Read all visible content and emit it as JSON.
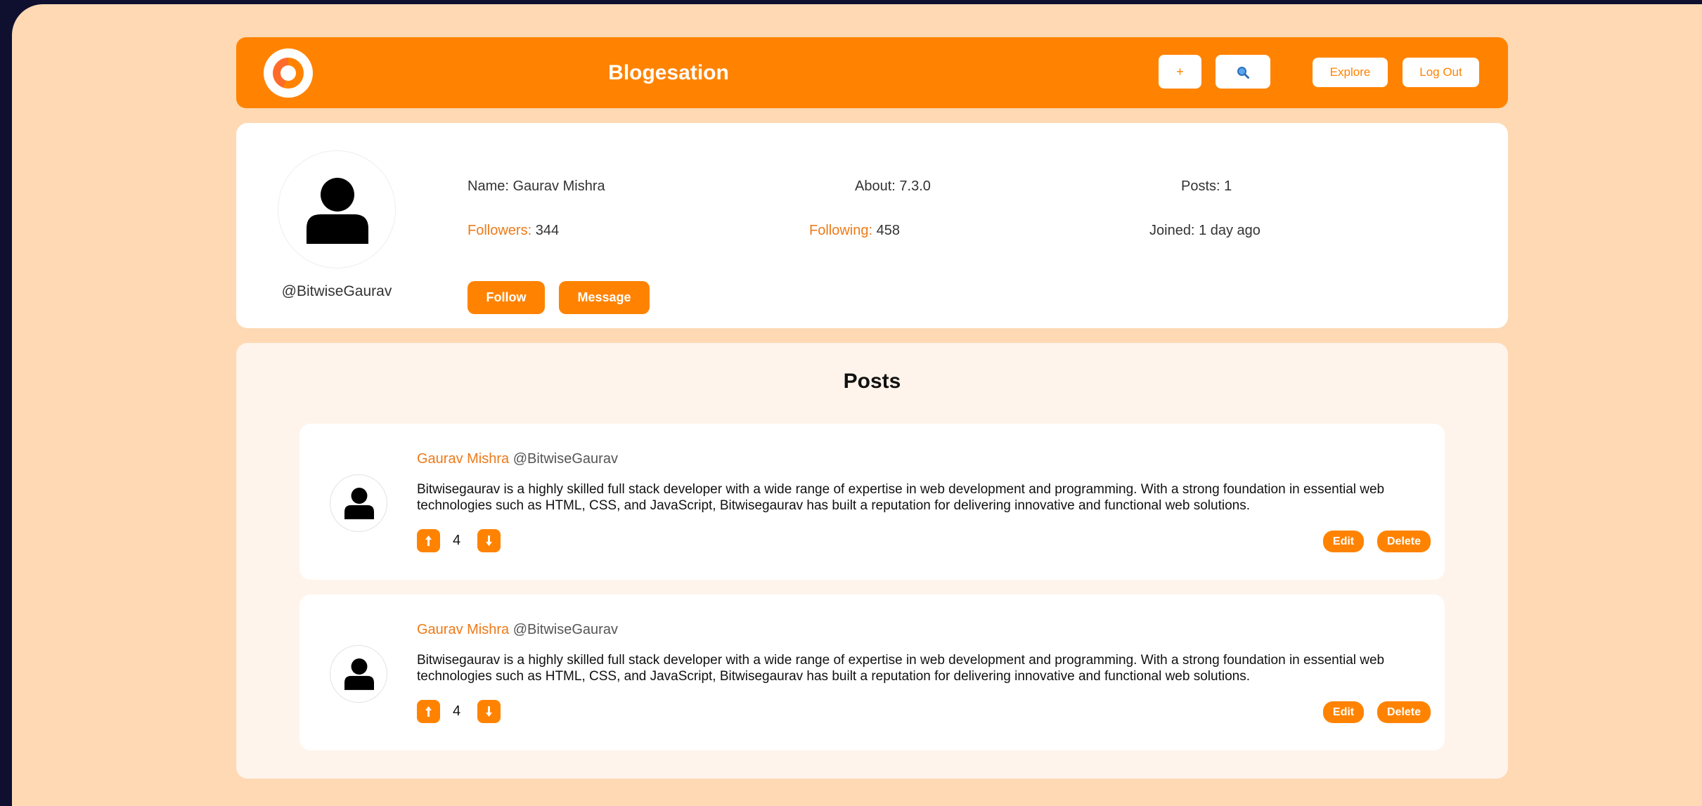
{
  "header": {
    "title": "Blogesation",
    "plus_label": "+",
    "explore_label": "Explore",
    "logout_label": "Log Out",
    "accent_color": "#ff8300"
  },
  "profile": {
    "name_label": "Name: ",
    "name": "Gaurav Mishra",
    "about_label": "About: ",
    "about": "7.3.0",
    "posts_label": "Posts: ",
    "posts": "1",
    "followers_label": "Followers:",
    "followers": "344",
    "following_label": "Following:",
    "following": "458",
    "joined_label": "Joined: ",
    "joined": "1 day ago",
    "handle": "@BitwiseGaurav",
    "follow_label": "Follow",
    "message_label": "Message"
  },
  "posts_section": {
    "title": "Posts",
    "posts": [
      {
        "author": "Gaurav Mishra",
        "handle": "@BitwiseGaurav",
        "body": "Bitwisegaurav is a highly skilled full stack developer with a wide range of expertise in web development and programming. With a strong foundation in essential web technologies such as HTML, CSS, and JavaScript, Bitwisegaurav has built a reputation for delivering innovative and functional web solutions.",
        "votes": "4",
        "edit_label": "Edit",
        "delete_label": "Delete"
      },
      {
        "author": "Gaurav Mishra",
        "handle": "@BitwiseGaurav",
        "body": "Bitwisegaurav is a highly skilled full stack developer with a wide range of expertise in web development and programming. With a strong foundation in essential web technologies such as HTML, CSS, and JavaScript, Bitwisegaurav has built a reputation for delivering innovative and functional web solutions.",
        "votes": "4",
        "edit_label": "Edit",
        "delete_label": "Delete"
      }
    ]
  },
  "icons": {
    "logo": "logo-ring-icon",
    "search": "search-icon",
    "avatar": "user-icon",
    "upvote": "arrow-up-icon",
    "downvote": "arrow-down-icon"
  }
}
